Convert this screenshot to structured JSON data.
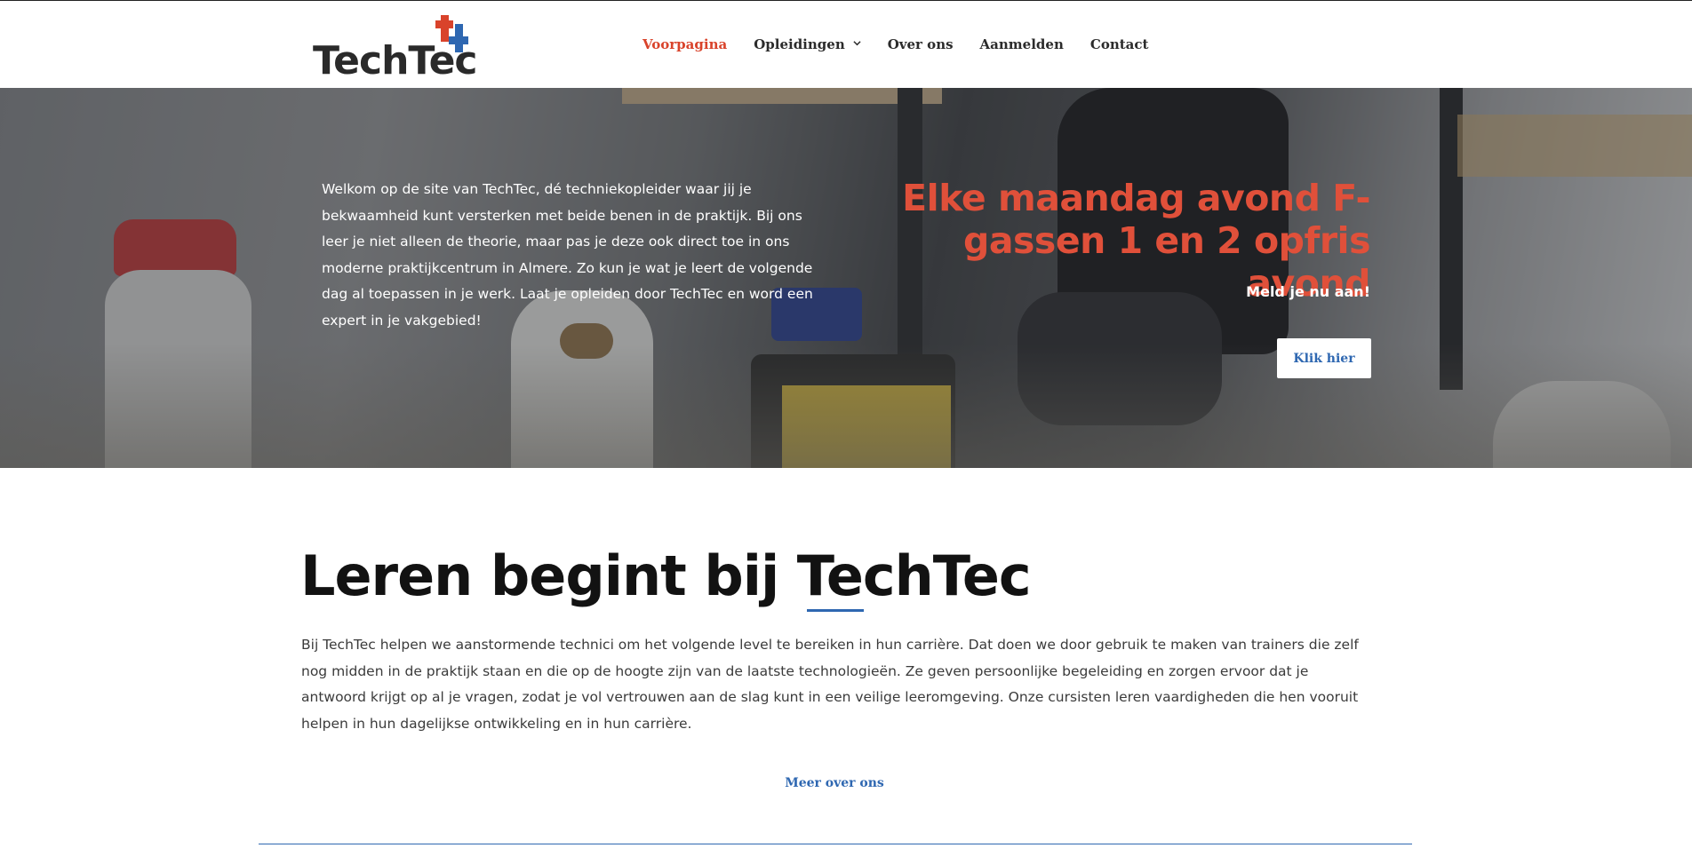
{
  "brand": {
    "logo_text": "TechTec",
    "colors": {
      "accent_red": "#d9432b",
      "accent_blue": "#2e67b1",
      "text_dark": "#2b2b2b"
    }
  },
  "nav": {
    "items": [
      {
        "label": "Voorpagina",
        "active": true
      },
      {
        "label": "Opleidingen",
        "has_dropdown": true
      },
      {
        "label": "Over ons"
      },
      {
        "label": "Aanmelden"
      },
      {
        "label": "Contact"
      }
    ]
  },
  "hero": {
    "intro_text": "Welkom op de site van TechTec, dé techniekopleider waar jij je bekwaamheid kunt versterken met beide benen in de praktijk. Bij ons leer je niet alleen de theorie, maar pas je deze ook direct toe in ons moderne praktijkcentrum in Almere. Zo kun je wat je leert de volgende dag al toepassen in je werk. Laat je opleiden door TechTec en word een expert in je vakgebied!",
    "promo_title": "Elke maandag avond F-gassen 1 en 2 opfris avond",
    "promo_subtitle": "Meld je nu aan!",
    "cta_label": "Klik hier"
  },
  "main": {
    "title": "Leren begint bij TechTec",
    "body": "Bij TechTec helpen we aanstormende technici om het volgende level te bereiken in hun carrière. Dat doen we door gebruik te maken van trainers die zelf nog midden in de praktijk staan en die op de hoogte zijn van de laatste technologieën. Ze geven persoonlijke begeleiding en zorgen ervoor dat je antwoord krijgt op al je vragen, zodat je vol vertrouwen aan de slag kunt in een veilige leeromgeving. Onze cursisten leren vaardigheden die hen vooruit helpen in hun dagelijkse ontwikkeling en in hun carrière.",
    "more_link": "Meer over ons"
  }
}
